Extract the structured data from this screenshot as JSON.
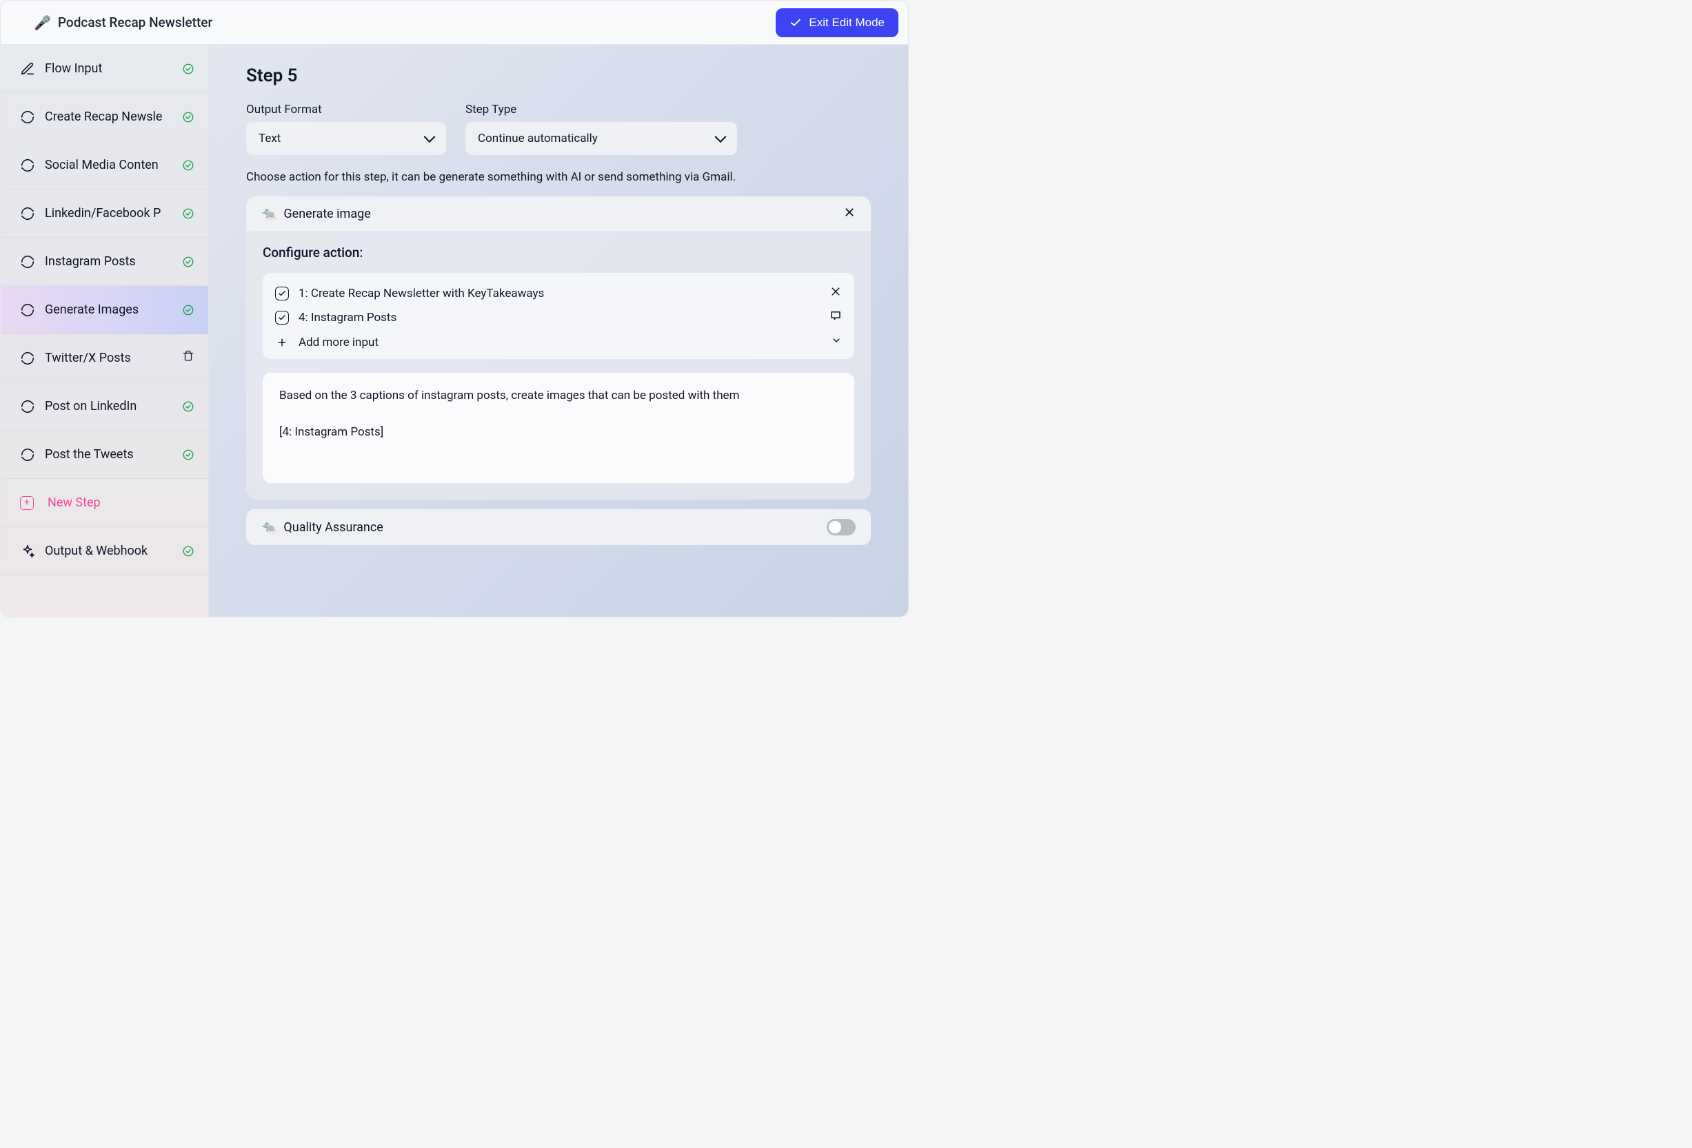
{
  "header": {
    "icon": "🎤",
    "title": "Podcast Recap Newsletter",
    "exit_label": "Exit Edit Mode"
  },
  "sidebar": {
    "items": [
      {
        "label": "Flow Input",
        "status": "ok",
        "icon": "edit"
      },
      {
        "label": "Create Recap Newsle",
        "status": "ok",
        "icon": "cycle"
      },
      {
        "label": "Social Media Conten",
        "status": "ok",
        "icon": "cycle"
      },
      {
        "label": "Linkedin/Facebook P",
        "status": "ok",
        "icon": "cycle"
      },
      {
        "label": "Instagram Posts",
        "status": "ok",
        "icon": "cycle"
      },
      {
        "label": "Generate Images",
        "status": "ok",
        "icon": "cycle",
        "active": true
      },
      {
        "label": "Twitter/X Posts",
        "status": "trash",
        "icon": "cycle"
      },
      {
        "label": "Post on LinkedIn",
        "status": "ok",
        "icon": "cycle"
      },
      {
        "label": "Post the Tweets",
        "status": "ok",
        "icon": "cycle"
      }
    ],
    "new_step_label": "New Step",
    "output_label": "Output & Webhook",
    "output_status": "ok"
  },
  "main": {
    "step_title": "Step 5",
    "output_format_label": "Output Format",
    "output_format_value": "Text",
    "step_type_label": "Step Type",
    "step_type_value": "Continue automatically",
    "description": "Choose action for this step, it can be generate something with AI or send something via Gmail.",
    "action": {
      "icon": "🐀",
      "title": "Generate image",
      "configure_title": "Configure action:",
      "inputs": [
        {
          "label": "1: Create Recap Newsletter with KeyTakeaways",
          "checked": true,
          "trailing": "close"
        },
        {
          "label": "4: Instagram Posts",
          "checked": true,
          "trailing": "comment"
        }
      ],
      "add_more_label": "Add more input",
      "prompt": "Based on the 3 captions of instagram posts, create images that can be posted with them\n\n[4: Instagram Posts]"
    },
    "qa": {
      "icon": "🐀",
      "label": "Quality Assurance",
      "enabled": false
    }
  }
}
